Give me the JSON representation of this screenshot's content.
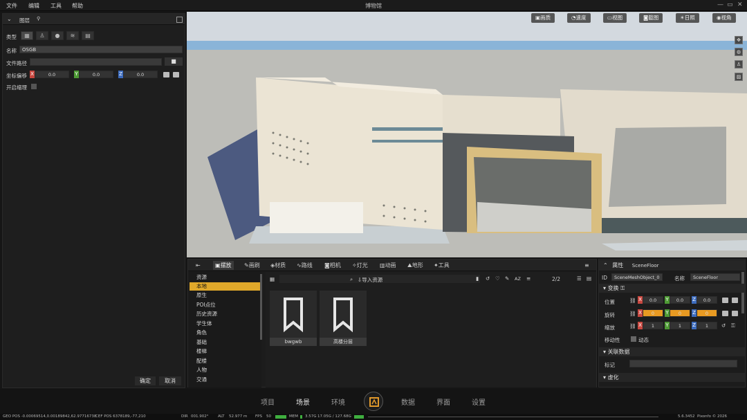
{
  "app": {
    "title": "博物馆",
    "menus": [
      "文件",
      "编辑",
      "工具",
      "帮助"
    ],
    "window_buttons": [
      "—",
      "▭",
      "✕"
    ]
  },
  "layer_panel": {
    "title": "图层",
    "labels": {
      "type": "类型",
      "name": "名称",
      "file_path": "文件路径",
      "offset": "坐标偏移",
      "enable_shadow": "开启缩理"
    },
    "name_value": "OSGB",
    "file_path_value": "",
    "offset": {
      "x": "0.0",
      "y": "0.0",
      "z": "0.0"
    },
    "confirm": "确定",
    "cancel": "取消"
  },
  "viewport": {
    "toolbar": [
      "画质",
      "速度",
      "视图",
      "截图",
      "日照",
      "视角"
    ],
    "colors": {
      "sky": "#cfd6de",
      "ground": "#b9b9b5",
      "building": "#e9e3d4",
      "wood": "#d8bd80"
    }
  },
  "assets": {
    "tabs": [
      "摆放",
      "画刷",
      "材质",
      "路线",
      "相机",
      "灯光",
      "动画",
      "地形",
      "工具"
    ],
    "active_tab": 0,
    "tree": [
      "资源",
      "本地",
      "原生",
      "POI点位",
      "历史资源",
      "学生体",
      "角色",
      "基础",
      "楼梯",
      "配楼",
      "人物",
      "交通"
    ],
    "selected_tree": 1,
    "search_placeholder": "",
    "import_label": "导入资源",
    "page": "2/2",
    "sort_label": "AZ",
    "items": [
      "bwgwb",
      "高楼分层"
    ]
  },
  "properties": {
    "title": "属性",
    "object_type": "SceneFloor",
    "id_label": "ID",
    "id_value": "SceneMeshObject_0",
    "name_label": "名称",
    "name_value": "SceneFloor",
    "transform_title": "变换",
    "position_label": "位置",
    "rotation_label": "旋转",
    "scale_label": "缩放",
    "position": {
      "x": "0.0",
      "y": "0.0",
      "z": "0.0"
    },
    "rotation": {
      "x": "0",
      "y": "0",
      "z": "0"
    },
    "scale": {
      "x": "1",
      "y": "1",
      "z": "1"
    },
    "mobility_label": "移动性",
    "mobility_value": "动态",
    "related_title": "关联数据",
    "tag_label": "标记",
    "tag_value": "",
    "virtual_title": "虚化"
  },
  "bottom_nav": {
    "items": [
      "项目",
      "场景",
      "环境",
      "数据",
      "界面",
      "设置"
    ],
    "active": 1
  },
  "status": {
    "geo": "GEO POS -0.00069514,0.00189842,62.97716738",
    "cef": "CEF POS 6378189,-77,210",
    "dir_label": "DIR",
    "dir": "001.902°",
    "alt_label": "ALT",
    "alt": "52.977 m",
    "fps_label": "FPS",
    "fps": "50",
    "mem_label": "MEM",
    "mem": "3.57G",
    "mem2": "17.05G / 127.68G",
    "version": "5.6.3452",
    "copyright": "Pixonfo © 2026"
  }
}
